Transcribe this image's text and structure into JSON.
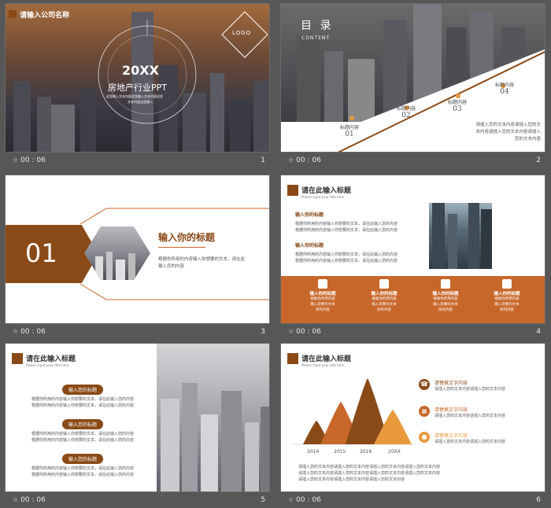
{
  "slides": [
    {
      "number": "1",
      "time": "00 : 06",
      "company": "请输入公司名称",
      "logo": "LOGO",
      "year": "20XX",
      "title": "房地产行业PPT",
      "sub1": "这里输入文本内容这里输入文本内容这里",
      "sub2": "文本内容这里输入"
    },
    {
      "number": "2",
      "time": "00 : 06",
      "title": "目 录",
      "subtitle": "CONTENT",
      "items": [
        {
          "label": "标题内容",
          "num": "01"
        },
        {
          "label": "标题内容",
          "num": "02"
        },
        {
          "label": "标题内容",
          "num": "03"
        },
        {
          "label": "标题内容",
          "num": "04"
        }
      ],
      "body": [
        "请插入您的文本内容请插入您的文",
        "本内容请插入您的文本内容请插入",
        "您的文本内容"
      ]
    },
    {
      "number": "3",
      "time": "00 : 06",
      "num": "01",
      "title": "输入你的标题",
      "body": [
        "根据你所用的内容输入你想要的文本，请在此",
        "输入您的内容"
      ]
    },
    {
      "number": "4",
      "time": "00 : 06",
      "title": "请在此输入标题",
      "subtitle": "Please input your title here",
      "blocks": [
        {
          "title": "输入你的标题",
          "lines": [
            "根据你所用的内容输入你想要的文本，请在此输入您的内容",
            "根据你所用的内容输入你想要的文本，请在此输入您的内容"
          ]
        },
        {
          "title": "输入你的标题",
          "lines": [
            "根据你所用的内容输入你想要的文本，请在此输入您的内容",
            "根据你所用的内容输入你想要的文本，请在此输入您的内容"
          ]
        }
      ],
      "features": [
        {
          "title": "输入你的标题",
          "l1": "根据你所用内容",
          "l2": "输入您要的文本",
          "l3": "你的内容"
        },
        {
          "title": "输入你的标题",
          "l1": "根据你所用内容",
          "l2": "输入您要的文本",
          "l3": "你的内容"
        },
        {
          "title": "输入你的标题",
          "l1": "根据你所用内容",
          "l2": "输入您要的文本",
          "l3": "你的内容"
        },
        {
          "title": "输入你的标题",
          "l1": "根据你所用内容",
          "l2": "输入您要的文本",
          "l3": "你的内容"
        }
      ]
    },
    {
      "number": "5",
      "time": "00 : 06",
      "title": "请在此输入标题",
      "subtitle": "Please input your title here",
      "blocks": [
        {
          "title": "输入您的标题",
          "l1": "根据你所用的内容输入你想要的文本，请在此输入您的内容",
          "l2": "根据你所用的内容输入你想要的文本，请在此输入您的内容"
        },
        {
          "title": "输入您的标题",
          "l1": "根据你所用的内容输入你想要的文本，请在此输入您的内容",
          "l2": "根据你所用的内容输入你想要的文本，请在此输入您的内容"
        },
        {
          "title": "输入您的标题",
          "l1": "根据你所用的内容输入你想要的文本，请在此输入您的内容",
          "l2": "根据你所用的内容输入你想要的文本，请在此输入您的内容"
        }
      ]
    },
    {
      "number": "6",
      "time": "00 : 06",
      "title": "请在此输入标题",
      "subtitle": "Please input your title here",
      "years": [
        "2014",
        "2015",
        "2016",
        "20XX"
      ],
      "items": [
        {
          "title": "请替换文字内容",
          "text": "请插入您的文本内容请插入您的文本内容",
          "color": "#8a4a17",
          "icon": "phone-icon"
        },
        {
          "title": "请替换文字内容",
          "text": "请插入您的文本内容请插入您的文本内容",
          "color": "#c8672a",
          "icon": "calendar-icon"
        },
        {
          "title": "请替换文字内容",
          "text": "请插入您的文本内容请插入您的文本内容",
          "color": "#e89a3c",
          "icon": "location-icon"
        }
      ],
      "body": [
        "请插入您的文本内容请插入您的文本内容请插入您的文本内容请插入您的文本内容",
        "请插入您的文本内容请插入您的文本内容请插入您的文本内容请插入您的文本内容",
        "请插入您的文本内容请插入您的文本内容请插入您的文本内容"
      ]
    }
  ],
  "colors": {
    "brand": "#8a4a17",
    "accent": "#c8672a",
    "light": "#e89a3c",
    "background": "#575757"
  }
}
